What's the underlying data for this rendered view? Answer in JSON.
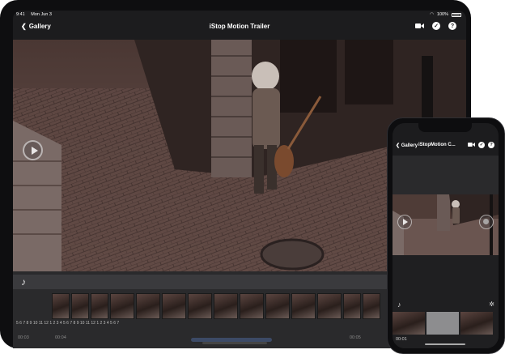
{
  "ipad": {
    "status": {
      "time": "9:41",
      "date": "Mon Jun 3",
      "battery": "100%"
    },
    "nav": {
      "back_label": "Gallery",
      "title": "iStop Motion Trailer",
      "icons": [
        "video-camera-icon",
        "check-circle-icon",
        "help-icon"
      ],
      "help_glyph": "?"
    },
    "timeline": {
      "frame_numbers": "5 6 7 8 9 10 11 12  1  2  3  4  5  6  7  8  9  10 11 12 1  2  3  4  5  6  7",
      "timecode_left": "00:03",
      "timecode_mid": "00:04",
      "timecode_right": "00:05"
    }
  },
  "iphone": {
    "nav": {
      "back_label": "Gallery",
      "title": "iStopMotion C...",
      "help_glyph": "?"
    },
    "timeline": {
      "timecode": "00:01"
    }
  },
  "colors": {
    "chrome": "#1c1c1e",
    "scene_base": "#3a2b28",
    "accent_scroll": "#3c4a66"
  }
}
